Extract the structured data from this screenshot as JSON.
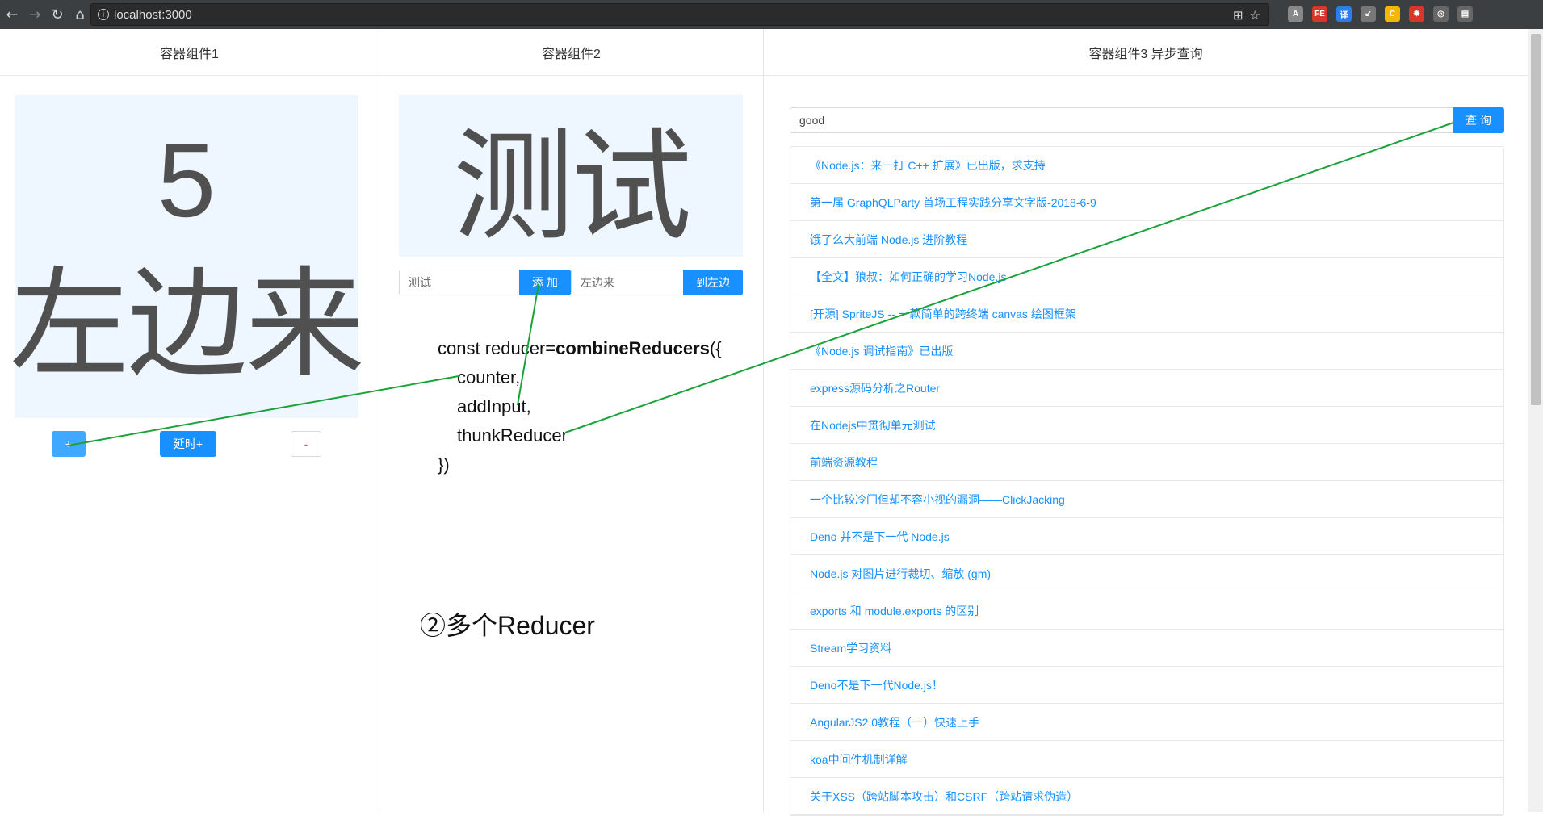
{
  "browser": {
    "url": "localhost:3000",
    "extensions": [
      {
        "name": "a-extension-icon",
        "label": "A",
        "color": "#888888"
      },
      {
        "name": "fe-extension-icon",
        "label": "FE",
        "color": "#d9362b"
      },
      {
        "name": "translate-extension-icon",
        "label": "译",
        "color": "#2b7de9"
      },
      {
        "name": "arrow-extension-icon",
        "label": "↙",
        "color": "#777777"
      },
      {
        "name": "coin-extension-icon",
        "label": "C",
        "color": "#f5b800"
      },
      {
        "name": "bug-extension-icon",
        "label": "✹",
        "color": "#d9362b"
      },
      {
        "name": "target-extension-icon",
        "label": "◎",
        "color": "#666666"
      },
      {
        "name": "screen-extension-icon",
        "label": "▤",
        "color": "#666666"
      }
    ]
  },
  "container1": {
    "title": "容器组件1",
    "count": "5",
    "text": "左边来",
    "plus_label": "+",
    "delay_plus_label": "延时+",
    "minus_label": "-"
  },
  "container2": {
    "title": "容器组件2",
    "display": "测试",
    "input_value": "测试",
    "add_label": "添 加",
    "input2_value": "左边来",
    "to_left_label": "到左边",
    "code_line1_prefix": "const reducer=",
    "code_line1_bold": "combineReducers",
    "code_line1_suffix": "({",
    "code_line2": "counter,",
    "code_line3": "addInput,",
    "code_line4": "thunkReducer",
    "code_line5": "})",
    "annotation": "②多个Reducer"
  },
  "container3": {
    "title": "容器组件3 异步查询",
    "search_value": "good",
    "search_label": "查 询",
    "results": [
      "《Node.js：来一打 C++ 扩展》已出版，求支持",
      "第一届 GraphQLParty 首场工程实践分享文字版-2018-6-9",
      "饿了么大前端 Node.js 进阶教程",
      "【全文】狼叔：如何正确的学习Node.js",
      "[开源] SpriteJS -- 一款简单的跨终端 canvas 绘图框架",
      "《Node.js 调试指南》已出版",
      "express源码分析之Router",
      "在Nodejs中贯彻单元测试",
      "前端资源教程",
      "一个比较冷门但却不容小视的漏洞——ClickJacking",
      "Deno 并不是下一代 Node.js",
      "Node.js 对图片进行裁切、缩放 (gm)",
      "exports 和 module.exports 的区别",
      "Stream学习资料",
      "Deno不是下一代Node.js！",
      "AngularJS2.0教程（一）快速上手",
      "koa中间件机制详解",
      "关于XSS（跨站脚本攻击）和CSRF（跨站请求伪造）"
    ]
  },
  "colors": {
    "primary": "#1890ff",
    "annotation_line": "#1aa33a"
  }
}
